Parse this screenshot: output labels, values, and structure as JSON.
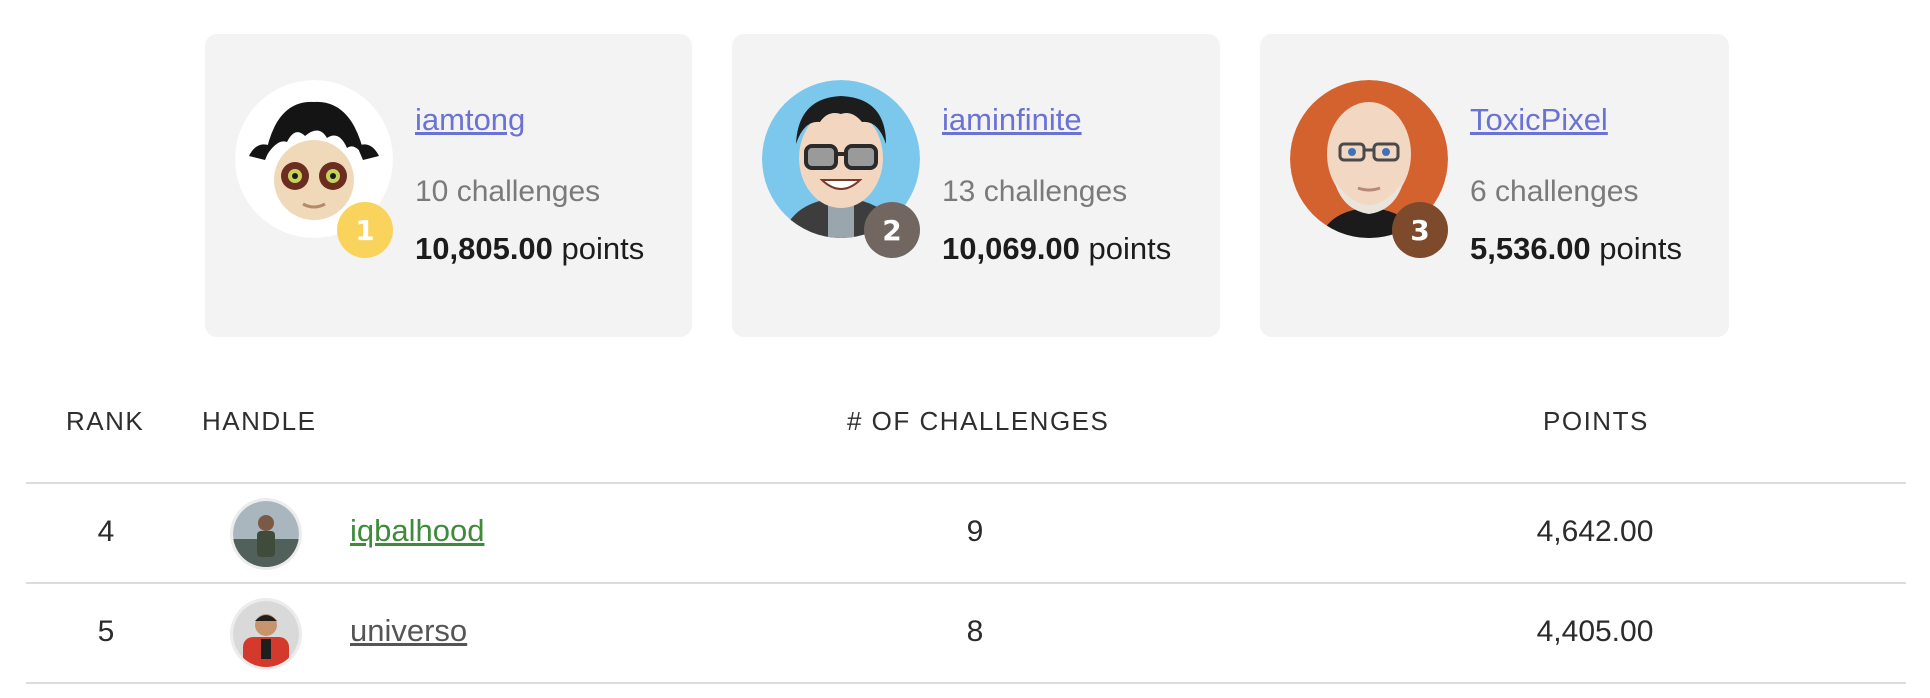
{
  "podium": [
    {
      "rank": "1",
      "handle": "iamtong",
      "challenges": "10 challenges",
      "points_value": "10,805.00",
      "points_unit": "points",
      "badge_color": "#f9d35c"
    },
    {
      "rank": "2",
      "handle": "iaminfinite",
      "challenges": "13 challenges",
      "points_value": "10,069.00",
      "points_unit": "points",
      "badge_color": "#726661"
    },
    {
      "rank": "3",
      "handle": "ToxicPixel",
      "challenges": "6 challenges",
      "points_value": "5,536.00",
      "points_unit": "points",
      "badge_color": "#7e4a2c"
    }
  ],
  "table": {
    "headers": {
      "rank": "RANK",
      "handle": "HANDLE",
      "challenges": "# OF CHALLENGES",
      "points": "POINTS"
    },
    "rows": [
      {
        "rank": "4",
        "handle": "iqbalhood",
        "handle_color": "#3d8b3b",
        "challenges": "9",
        "points": "4,642.00"
      },
      {
        "rank": "5",
        "handle": "universo",
        "handle_color": "#555555",
        "challenges": "8",
        "points": "4,405.00"
      }
    ]
  },
  "colors": {
    "link": "#6a72d6",
    "card_bg": "#f3f3f3",
    "rule": "#dcdcdc"
  }
}
